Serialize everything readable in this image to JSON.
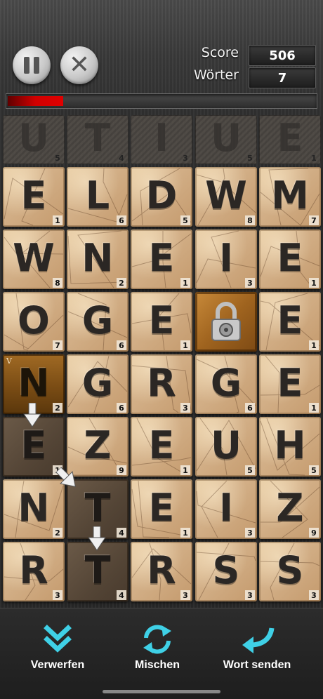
{
  "header": {
    "score_label": "Score",
    "score_value": "506",
    "words_label": "Wörter",
    "words_value": "7",
    "progress_fraction": 0.18,
    "pause_icon": "pause-icon",
    "close_icon": "close-icon"
  },
  "preview_row": [
    {
      "letter": "U",
      "points": "5"
    },
    {
      "letter": "T",
      "points": "4"
    },
    {
      "letter": "I",
      "points": "3"
    },
    {
      "letter": "U",
      "points": "5"
    },
    {
      "letter": "E",
      "points": "1"
    }
  ],
  "grid": [
    [
      {
        "letter": "E",
        "points": "1",
        "state": "normal"
      },
      {
        "letter": "L",
        "points": "6",
        "state": "normal"
      },
      {
        "letter": "D",
        "points": "5",
        "state": "normal"
      },
      {
        "letter": "W",
        "points": "8",
        "state": "normal"
      },
      {
        "letter": "M",
        "points": "7",
        "state": "normal"
      }
    ],
    [
      {
        "letter": "W",
        "points": "8",
        "state": "normal"
      },
      {
        "letter": "N",
        "points": "2",
        "state": "normal"
      },
      {
        "letter": "E",
        "points": "1",
        "state": "normal"
      },
      {
        "letter": "I",
        "points": "3",
        "state": "normal"
      },
      {
        "letter": "E",
        "points": "1",
        "state": "normal"
      }
    ],
    [
      {
        "letter": "O",
        "points": "7",
        "state": "normal"
      },
      {
        "letter": "G",
        "points": "6",
        "state": "normal"
      },
      {
        "letter": "E",
        "points": "1",
        "state": "normal"
      },
      {
        "letter": "",
        "points": "",
        "state": "locked"
      },
      {
        "letter": "E",
        "points": "1",
        "state": "normal"
      }
    ],
    [
      {
        "letter": "N",
        "points": "2",
        "state": "current",
        "bonus": "V"
      },
      {
        "letter": "G",
        "points": "6",
        "state": "normal"
      },
      {
        "letter": "R",
        "points": "3",
        "state": "normal"
      },
      {
        "letter": "G",
        "points": "6",
        "state": "normal"
      },
      {
        "letter": "E",
        "points": "1",
        "state": "normal"
      }
    ],
    [
      {
        "letter": "E",
        "points": "1",
        "state": "selected"
      },
      {
        "letter": "Z",
        "points": "9",
        "state": "normal"
      },
      {
        "letter": "E",
        "points": "1",
        "state": "normal"
      },
      {
        "letter": "U",
        "points": "5",
        "state": "normal"
      },
      {
        "letter": "H",
        "points": "5",
        "state": "normal"
      }
    ],
    [
      {
        "letter": "N",
        "points": "2",
        "state": "normal"
      },
      {
        "letter": "T",
        "points": "4",
        "state": "selected"
      },
      {
        "letter": "E",
        "points": "1",
        "state": "normal"
      },
      {
        "letter": "I",
        "points": "3",
        "state": "normal"
      },
      {
        "letter": "Z",
        "points": "9",
        "state": "normal"
      }
    ],
    [
      {
        "letter": "R",
        "points": "3",
        "state": "normal"
      },
      {
        "letter": "T",
        "points": "4",
        "state": "selected"
      },
      {
        "letter": "R",
        "points": "3",
        "state": "normal"
      },
      {
        "letter": "S",
        "points": "3",
        "state": "normal"
      },
      {
        "letter": "S",
        "points": "3",
        "state": "normal"
      }
    ]
  ],
  "toolbar": {
    "discard_label": "Verwerfen",
    "shuffle_label": "Mischen",
    "send_label": "Wort senden"
  },
  "colors": {
    "accent_cyan": "#3fd0e6",
    "progress_red": "#d10000"
  }
}
